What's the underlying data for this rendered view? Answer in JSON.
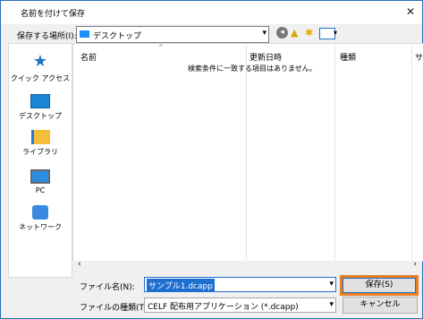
{
  "dialog": {
    "title": "名前を付けて保存"
  },
  "location": {
    "label": "保存する場所(I):",
    "value": "デスクトップ"
  },
  "sidebar": {
    "items": [
      {
        "label": "クイック アクセス"
      },
      {
        "label": "デスクトップ"
      },
      {
        "label": "ライブラリ"
      },
      {
        "label": "PC"
      },
      {
        "label": "ネットワーク"
      }
    ]
  },
  "list": {
    "columns": [
      "名前",
      "更新日時",
      "種類",
      "サ"
    ],
    "empty_message": "検索条件に一致する項目はありません。"
  },
  "filename": {
    "label": "ファイル名(N):",
    "value": "サンプル1.dcapp"
  },
  "filetype": {
    "label": "ファイルの種類(T):",
    "value": "CELF 配布用アプリケーション (*.dcapp)"
  },
  "buttons": {
    "save": "保存(S)",
    "cancel": "キャンセル"
  },
  "colors": {
    "accent": "#1f6fd1",
    "highlight": "#e67e22"
  }
}
